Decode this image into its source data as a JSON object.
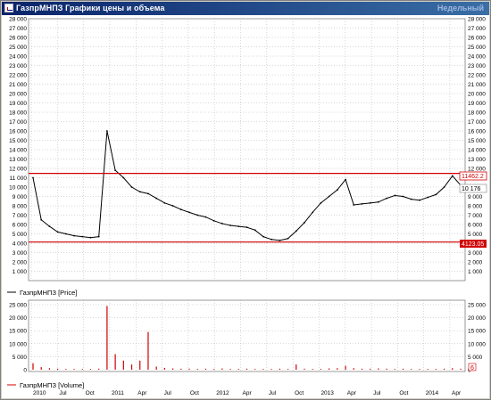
{
  "window": {
    "title": "ГазпрМНПЗ Графики цены и объема",
    "period": "Недельный"
  },
  "colors": {
    "price": "#000000",
    "level": "#d00000",
    "volume": "#d00000",
    "grid": "#b0b0b0"
  },
  "price_panel": {
    "legend": "ГазпрМНПЗ [Price]",
    "y_ticks": [
      "1 000",
      "2 000",
      "3 000",
      "4 000",
      "5 000",
      "6 000",
      "7 000",
      "8 000",
      "9 000",
      "10 000",
      "11 000",
      "12 000",
      "13 000",
      "14 000",
      "15 000",
      "16 000",
      "17 000",
      "18 000",
      "19 000",
      "20 000",
      "21 000",
      "22 000",
      "23 000",
      "24 000",
      "25 000",
      "26 000",
      "27 000",
      "28 000"
    ],
    "level_high_label": "11462.2",
    "level_low_label": "4123.05",
    "last_price_label": "10 176"
  },
  "volume_panel": {
    "legend": "ГазпрМНПЗ [Volume]",
    "y_ticks": [
      "0",
      "5 000",
      "10 000",
      "15 000",
      "20 000",
      "25 000"
    ],
    "last_volume_label": "6"
  },
  "x_axis": {
    "labels": [
      "2010",
      "Jul",
      "Oct",
      "2011",
      "Apr",
      "Jul",
      "Oct",
      "2012",
      "Apr",
      "Jul",
      "Oct",
      "2013",
      "Apr",
      "Jul",
      "Oct",
      "2014",
      "Apr"
    ]
  },
  "chart_data": [
    {
      "type": "line",
      "name": "ГазпрМНПЗ [Price]",
      "y_range": [
        0,
        28000
      ],
      "levels": [
        11462.2,
        4123.05
      ],
      "x": [
        "2010-01",
        "2010-02",
        "2010-03",
        "2010-04",
        "2010-05",
        "2010-06",
        "2010-07",
        "2010-08",
        "2010-09",
        "2010-10",
        "2010-11",
        "2010-12",
        "2011-01",
        "2011-02",
        "2011-03",
        "2011-04",
        "2011-05",
        "2011-06",
        "2011-07",
        "2011-08",
        "2011-09",
        "2011-10",
        "2011-11",
        "2011-12",
        "2012-01",
        "2012-02",
        "2012-03",
        "2012-04",
        "2012-05",
        "2012-06",
        "2012-07",
        "2012-08",
        "2012-09",
        "2012-10",
        "2012-11",
        "2012-12",
        "2013-01",
        "2013-02",
        "2013-03",
        "2013-04",
        "2013-05",
        "2013-06",
        "2013-07",
        "2013-08",
        "2013-09",
        "2013-10",
        "2013-11",
        "2013-12",
        "2014-01",
        "2014-02",
        "2014-03",
        "2014-04",
        "2014-05"
      ],
      "y": [
        11000,
        6500,
        5800,
        5200,
        5000,
        4800,
        4700,
        4600,
        4700,
        16000,
        11800,
        11000,
        10000,
        9500,
        9300,
        8800,
        8300,
        8000,
        7600,
        7300,
        7000,
        6800,
        6400,
        6100,
        5900,
        5800,
        5700,
        5400,
        4700,
        4400,
        4300,
        4500,
        5300,
        6200,
        7300,
        8300,
        9000,
        9700,
        10800,
        8100,
        8200,
        8300,
        8400,
        8800,
        9100,
        9000,
        8700,
        8600,
        8900,
        9200,
        10000,
        11200,
        10200
      ]
    },
    {
      "type": "bar",
      "name": "ГазпрМНПЗ [Volume]",
      "y_range": [
        0,
        25000
      ],
      "x": [
        "2010-01",
        "2010-02",
        "2010-03",
        "2010-04",
        "2010-05",
        "2010-06",
        "2010-07",
        "2010-08",
        "2010-09",
        "2010-10",
        "2010-11",
        "2010-12",
        "2011-01",
        "2011-02",
        "2011-03",
        "2011-04",
        "2011-05",
        "2011-06",
        "2011-07",
        "2011-08",
        "2011-09",
        "2011-10",
        "2011-11",
        "2011-12",
        "2012-01",
        "2012-02",
        "2012-03",
        "2012-04",
        "2012-05",
        "2012-06",
        "2012-07",
        "2012-08",
        "2012-09",
        "2012-10",
        "2012-11",
        "2012-12",
        "2013-01",
        "2013-02",
        "2013-03",
        "2013-04",
        "2013-05",
        "2013-06",
        "2013-07",
        "2013-08",
        "2013-09",
        "2013-10",
        "2013-11",
        "2013-12",
        "2014-01",
        "2014-02",
        "2014-03",
        "2014-04",
        "2014-05"
      ],
      "y": [
        2500,
        1000,
        600,
        400,
        300,
        300,
        300,
        300,
        400,
        24500,
        6000,
        3500,
        2000,
        3500,
        14500,
        1200,
        700,
        500,
        400,
        400,
        300,
        400,
        300,
        500,
        300,
        300,
        400,
        300,
        300,
        300,
        400,
        300,
        2000,
        400,
        300,
        300,
        500,
        600,
        1500,
        600,
        400,
        400,
        500,
        400,
        300,
        400,
        300,
        300,
        300,
        300,
        400,
        600,
        400
      ]
    }
  ]
}
